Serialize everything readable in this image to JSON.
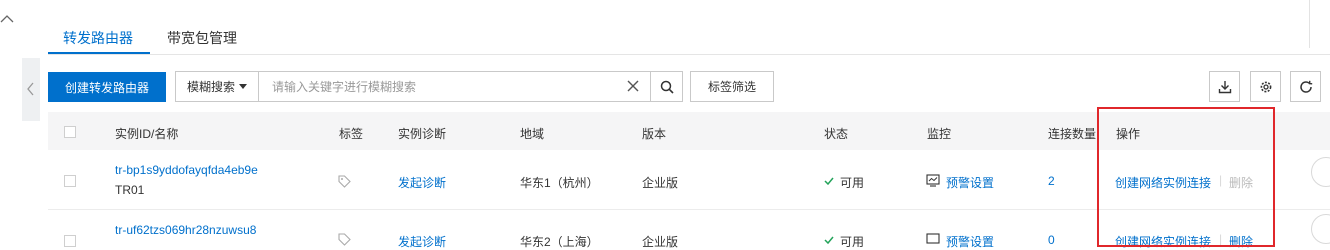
{
  "tabs": [
    {
      "label": "转发路由器",
      "active": true
    },
    {
      "label": "带宽包管理",
      "active": false
    }
  ],
  "toolbar": {
    "create_label": "创建转发路由器",
    "search_mode": "模糊搜索",
    "search_placeholder": "请输入关键字进行模糊搜索",
    "tag_filter_label": "标签筛选"
  },
  "columns": {
    "id_name": "实例ID/名称",
    "tags": "标签",
    "diagnosis": "实例诊断",
    "region": "地域",
    "edition": "版本",
    "status": "状态",
    "monitor": "监控",
    "connections": "连接数量",
    "actions": "操作"
  },
  "rows": [
    {
      "id": "tr-bp1s9yddofayqfda4eb9e",
      "name": "TR01",
      "diagnosis": "发起诊断",
      "region": "华东1（杭州）",
      "edition": "企业版",
      "status": "可用",
      "monitor": "预警设置",
      "connections": "2",
      "action_create": "创建网络实例连接",
      "action_delete": "删除"
    },
    {
      "id": "tr-uf62tzs069hr28nzuwsu8",
      "name": "",
      "diagnosis": "发起诊断",
      "region": "华东2（上海）",
      "edition": "企业版",
      "status": "可用",
      "monitor": "预警设置",
      "connections": "0",
      "action_create": "创建网络实例连接",
      "action_delete": "删除"
    }
  ],
  "colors": {
    "primary": "#0070cc",
    "highlight_box": "#e0272b",
    "success": "#23a35a"
  },
  "icons": [
    "chevron-up-icon",
    "chevron-left-icon",
    "clear-icon",
    "search-icon",
    "download-icon",
    "settings-icon",
    "refresh-icon",
    "tag-icon",
    "check-icon",
    "monitor-icon"
  ]
}
